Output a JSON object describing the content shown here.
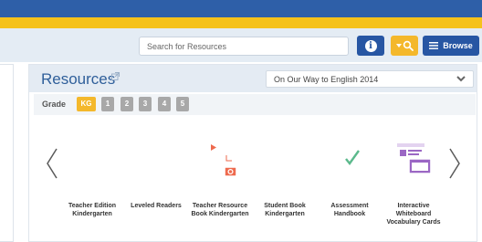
{
  "search": {
    "placeholder": "Search for Resources"
  },
  "header": {
    "browse_label": "Browse"
  },
  "resources": {
    "title": "Resources",
    "program": "On Our Way to English 2014",
    "grade_label": "Grade",
    "grades": [
      "KG",
      "1",
      "2",
      "3",
      "4",
      "5"
    ],
    "selected_grade": "KG",
    "items": [
      {
        "label": "Teacher Edition Kindergarten",
        "color": "#ee6a4e",
        "icon": "open-book-icon"
      },
      {
        "label": "Leveled Readers",
        "color": "#ee6a4e",
        "icon": "open-book-icon"
      },
      {
        "label": "Teacher Resource Book Kindergarten",
        "color": "#ee6a4e",
        "icon": "media-document-icon"
      },
      {
        "label": "Student Book Kindergarten",
        "color": "#f8d342",
        "icon": "open-book-icon"
      },
      {
        "label": "Assessment Handbook",
        "color": "#5bb98c",
        "icon": "checklist-icon"
      },
      {
        "label": "Interactive Whiteboard Vocabulary Cards",
        "color": "#9b67c4",
        "icon": "whiteboard-icon"
      }
    ]
  },
  "colors": {
    "brand_blue": "#2e5fa8",
    "brand_yellow": "#f5c21b",
    "grade_active": "#f4b82b",
    "grade_inactive": "#a8a8a8"
  }
}
